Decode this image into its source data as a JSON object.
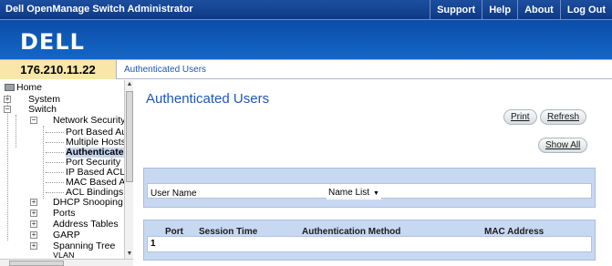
{
  "header": {
    "app_title": "Dell OpenManage Switch Administrator",
    "menu": [
      "Support",
      "Help",
      "About",
      "Log Out"
    ]
  },
  "brand": {
    "logo_text": "DELL"
  },
  "address": {
    "ip": "176.210.11.22",
    "breadcrumb": "Authenticated Users"
  },
  "tree": {
    "items": [
      "Home",
      "System",
      "Switch",
      "Network Security",
      "Port Based Au",
      "Multiple Hosts",
      "Authenticated",
      "Port Security",
      "IP Based ACL",
      "MAC Based A",
      "ACL Bindings",
      "DHCP Snooping",
      "Ports",
      "Address Tables",
      "GARP",
      "Spanning Tree",
      "VLAN"
    ],
    "selected_index": 6
  },
  "main": {
    "title": "Authenticated Users",
    "buttons": {
      "print": "Print",
      "refresh": "Refresh",
      "show_all": "Show All"
    },
    "filter": {
      "label": "User Name",
      "selected": "Name List"
    },
    "table": {
      "columns": [
        "Port",
        "Session Time",
        "Authentication Method",
        "MAC Address"
      ],
      "rows": [
        [
          "1",
          "",
          "",
          ""
        ]
      ]
    }
  },
  "colors": {
    "header_blue": "#0d3a86",
    "brand_blue": "#1466c6",
    "title_blue": "#1f57b5",
    "ip_bg": "#f8e7a9",
    "panel_blue": "#c7d8f1"
  }
}
